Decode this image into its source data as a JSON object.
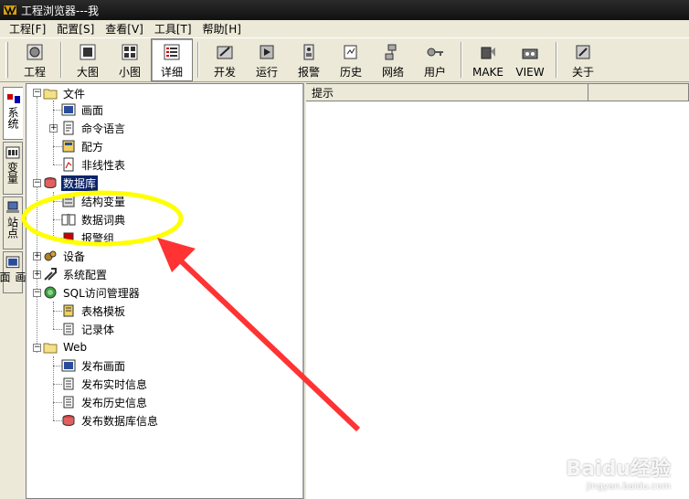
{
  "window": {
    "title": "工程浏览器---我"
  },
  "menu": [
    "工程[F]",
    "配置[S]",
    "查看[V]",
    "工具[T]",
    "帮助[H]"
  ],
  "toolbar": {
    "buttons": [
      {
        "label": "工程",
        "icon": "project-icon"
      },
      {
        "label": "大图",
        "icon": "large-icons-icon"
      },
      {
        "label": "小图",
        "icon": "small-icons-icon"
      },
      {
        "label": "详细",
        "icon": "details-icon",
        "active": true
      },
      {
        "label": "开发",
        "icon": "develop-icon"
      },
      {
        "label": "运行",
        "icon": "run-icon"
      },
      {
        "label": "报警",
        "icon": "alarm-icon"
      },
      {
        "label": "历史",
        "icon": "history-icon"
      },
      {
        "label": "网络",
        "icon": "network-icon"
      },
      {
        "label": "用户",
        "icon": "user-key-icon"
      },
      {
        "label": "MAKE",
        "icon": "make-icon"
      },
      {
        "label": "VIEW",
        "icon": "view-icon"
      },
      {
        "label": "关于",
        "icon": "about-icon"
      }
    ]
  },
  "side_tabs": [
    "系统",
    "变量",
    "站点",
    "画面"
  ],
  "tree": {
    "items": [
      {
        "label": "文件",
        "icon": "folder-icon"
      },
      {
        "label": "画面",
        "icon": "screen-icon"
      },
      {
        "label": "命令语言",
        "icon": "script-icon"
      },
      {
        "label": "配方",
        "icon": "recipe-icon"
      },
      {
        "label": "非线性表",
        "icon": "table-icon"
      },
      {
        "label": "数据库",
        "icon": "database-icon",
        "selected": true
      },
      {
        "label": "结构变量",
        "icon": "struct-icon"
      },
      {
        "label": "数据词典",
        "icon": "dictionary-icon"
      },
      {
        "label": "报警组",
        "icon": "alarm-group-icon"
      },
      {
        "label": "设备",
        "icon": "device-icon"
      },
      {
        "label": "系统配置",
        "icon": "tools-icon"
      },
      {
        "label": "SQL访问管理器",
        "icon": "sql-icon"
      },
      {
        "label": "表格模板",
        "icon": "template-icon"
      },
      {
        "label": "记录体",
        "icon": "record-icon"
      },
      {
        "label": "Web",
        "icon": "folder-icon"
      },
      {
        "label": "发布画面",
        "icon": "publish-screen-icon"
      },
      {
        "label": "发布实时信息",
        "icon": "publish-realtime-icon"
      },
      {
        "label": "发布历史信息",
        "icon": "publish-history-icon"
      },
      {
        "label": "发布数据库信息",
        "icon": "publish-db-icon"
      }
    ]
  },
  "detail_header": "提示",
  "annotation": {
    "ellipse_color": "#ffff00",
    "arrow_color": "#ff3333"
  },
  "watermark": {
    "main": "Baidu经验",
    "sub": "jingyan.baidu.com"
  }
}
